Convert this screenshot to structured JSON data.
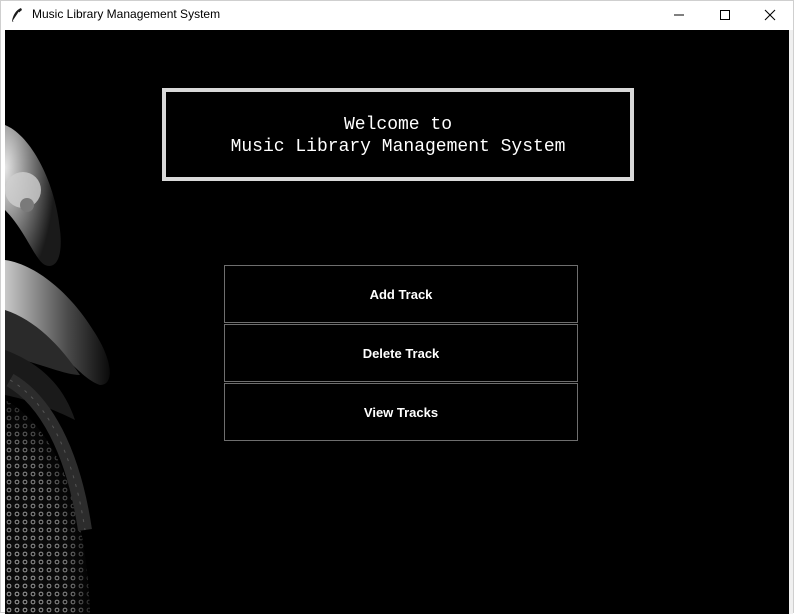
{
  "window": {
    "title": "Music Library Management System",
    "icon": "feather-icon"
  },
  "controls": {
    "minimize_icon": "minimize-icon",
    "maximize_icon": "maximize-icon",
    "close_icon": "close-icon"
  },
  "main": {
    "welcome_line1": "Welcome to",
    "welcome_line2": "Music Library Management System",
    "background_image": "headphones-image"
  },
  "menu": {
    "add_label": "Add Track",
    "delete_label": "Delete Track",
    "view_label": "View Tracks"
  },
  "colors": {
    "background": "#000000",
    "text": "#ffffff",
    "welcome_border": "#d9d9d9",
    "button_border": "#6e6e6e"
  }
}
